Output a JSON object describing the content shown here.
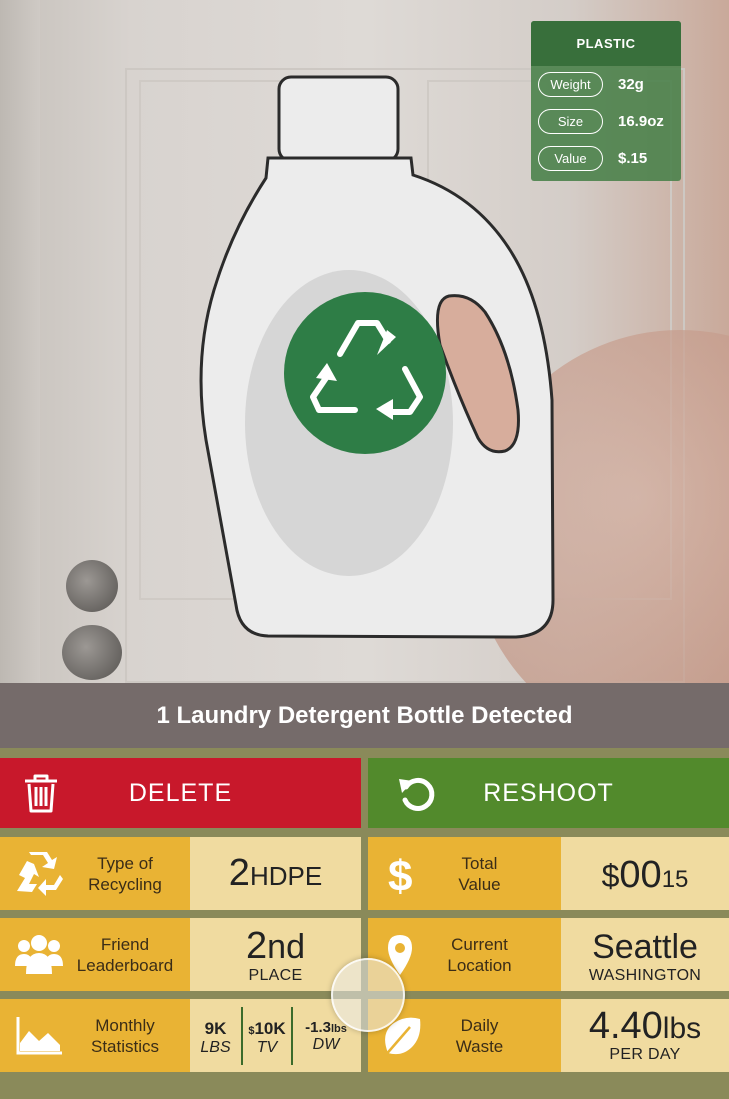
{
  "info_card": {
    "material": "PLASTIC",
    "rows": [
      {
        "label": "Weight",
        "value": "32g"
      },
      {
        "label": "Size",
        "value": "16.9oz"
      },
      {
        "label": "Value",
        "value": "$.15"
      }
    ]
  },
  "detection": {
    "banner": "1 Laundry Detergent Bottle Detected"
  },
  "actions": {
    "delete_label": "DELETE",
    "reshoot_label": "RESHOOT"
  },
  "stats": {
    "recycling_type": {
      "label_line1": "Type of",
      "label_line2": "Recycling",
      "number": "2",
      "code": "HDPE"
    },
    "total_value": {
      "label_line1": "Total",
      "label_line2": "Value",
      "currency": "$",
      "dollars": "00",
      "cents": "15"
    },
    "leaderboard": {
      "label_line1": "Friend",
      "label_line2": "Leaderboard",
      "place_num": "2",
      "place_suffix": "nd",
      "place_word": "PLACE"
    },
    "location": {
      "label_line1": "Current",
      "label_line2": "Location",
      "city": "Seattle",
      "state": "WASHINGTON"
    },
    "monthly": {
      "label_line1": "Monthly",
      "label_line2": "Statistics",
      "items": [
        {
          "prefix": "",
          "value": "9K",
          "unit": "",
          "caption": "LBS"
        },
        {
          "prefix": "$",
          "value": "10K",
          "unit": "",
          "caption": "TV"
        },
        {
          "prefix": "",
          "value": "-1.3",
          "unit": "lbs",
          "caption": "DW"
        }
      ]
    },
    "daily_waste": {
      "label_line1": "Daily",
      "label_line2": "Waste",
      "value": "4.40",
      "unit": "lbs",
      "per": "PER DAY"
    }
  },
  "colors": {
    "delete": "#c8182b",
    "reshoot": "#528a2c",
    "tile_label": "#e9b334",
    "tile_value": "#f0dba0",
    "badge_green": "#2e7d46"
  },
  "icons": [
    "recycle-icon",
    "trash-icon",
    "reshoot-icon",
    "dollar-icon",
    "people-icon",
    "location-pin-icon",
    "area-chart-icon",
    "leaf-icon"
  ]
}
